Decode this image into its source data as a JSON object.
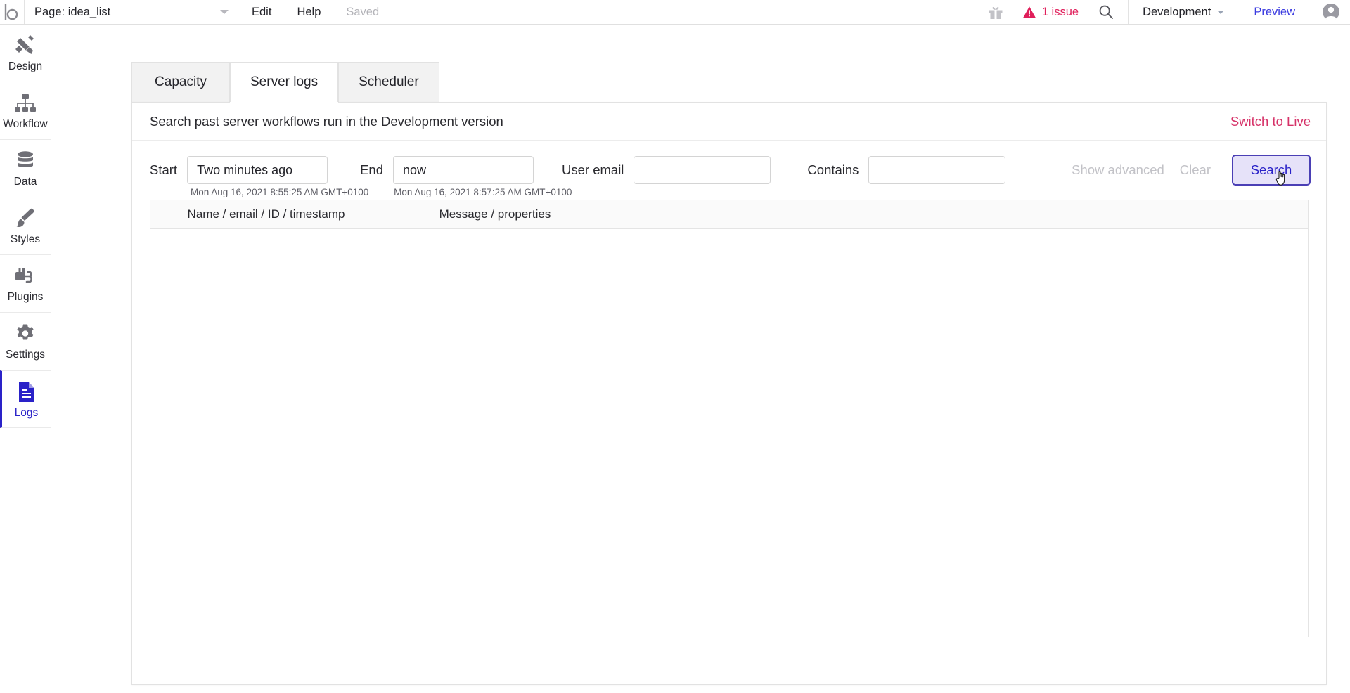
{
  "topbar": {
    "logo": "bubble-logo",
    "page_label": "Page: idea_list",
    "menu": [
      {
        "label": "Edit",
        "muted": false
      },
      {
        "label": "Help",
        "muted": false
      },
      {
        "label": "Saved",
        "muted": true
      }
    ],
    "gift_icon": "gift-icon",
    "issue": {
      "icon": "warning-triangle-icon",
      "text": "1 issue",
      "color": "#e01e5a"
    },
    "search_icon": "search-icon",
    "version": "Development",
    "preview_label": "Preview",
    "avatar": "user-avatar-icon"
  },
  "sidebar": {
    "items": [
      {
        "label": "Design",
        "icon": "design-pencil-ruler-icon",
        "selected": false
      },
      {
        "label": "Workflow",
        "icon": "workflow-org-chart-icon",
        "selected": false
      },
      {
        "label": "Data",
        "icon": "data-database-icon",
        "selected": false
      },
      {
        "label": "Styles",
        "icon": "styles-brush-icon",
        "selected": false
      },
      {
        "label": "Plugins",
        "icon": "plugins-plug-icon",
        "selected": false
      },
      {
        "label": "Settings",
        "icon": "settings-gear-icon",
        "selected": false
      },
      {
        "label": "Logs",
        "icon": "logs-document-icon",
        "selected": true
      }
    ],
    "selected_color": "#2a22c8"
  },
  "tabs": [
    {
      "label": "Capacity",
      "active": false
    },
    {
      "label": "Server logs",
      "active": true
    },
    {
      "label": "Scheduler",
      "active": false
    }
  ],
  "panel": {
    "title": "Search past server workflows run in the Development version",
    "switch_link": "Switch to Live",
    "switch_link_color": "#d63268"
  },
  "filters": {
    "start": {
      "label": "Start",
      "value": "Two minutes ago",
      "placeholder": "",
      "hint": "Mon Aug 16, 2021 8:55:25 AM GMT+0100"
    },
    "end": {
      "label": "End",
      "value": "now",
      "placeholder": "",
      "hint": "Mon Aug 16, 2021 8:57:25 AM GMT+0100"
    },
    "user_email": {
      "label": "User email",
      "value": "",
      "placeholder": ""
    },
    "contains": {
      "label": "Contains",
      "value": "",
      "placeholder": ""
    },
    "show_advanced": "Show advanced",
    "clear": "Clear",
    "search_button": "Search",
    "search_button_bg": "#e6e2f9",
    "search_button_border": "#4a3fb5",
    "search_button_text_color": "#2a22c8"
  },
  "results_table": {
    "columns": [
      "Name / email / ID / timestamp",
      "Message / properties"
    ],
    "rows": []
  },
  "cursor": {
    "type": "pointing-hand",
    "over": "search-button"
  }
}
